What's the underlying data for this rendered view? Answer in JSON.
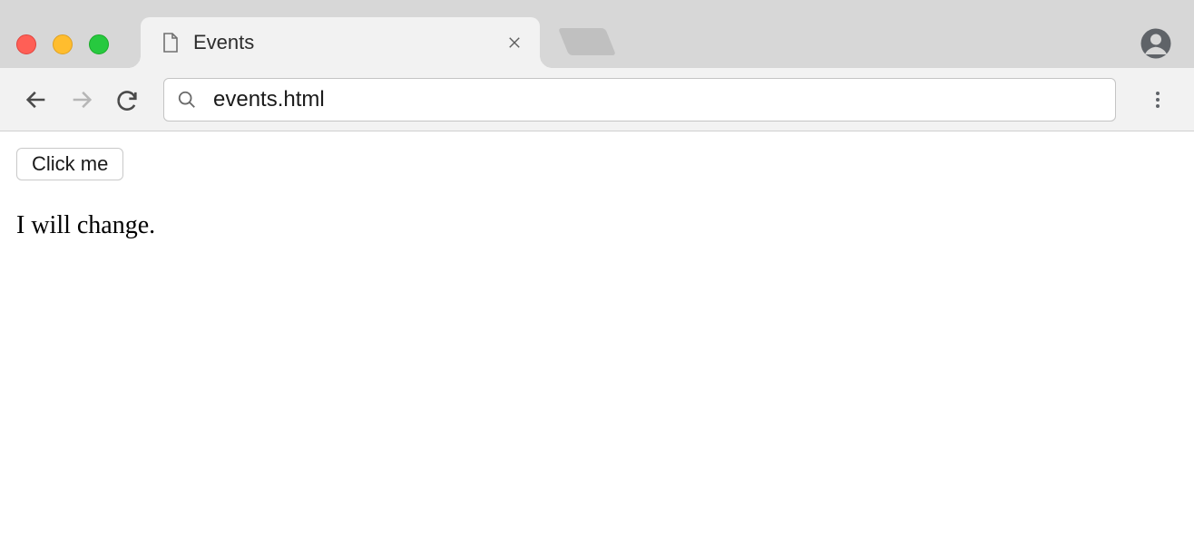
{
  "window": {
    "tab_title": "Events",
    "address_bar": "events.html"
  },
  "page": {
    "button_label": "Click me",
    "paragraph": "I will change."
  }
}
